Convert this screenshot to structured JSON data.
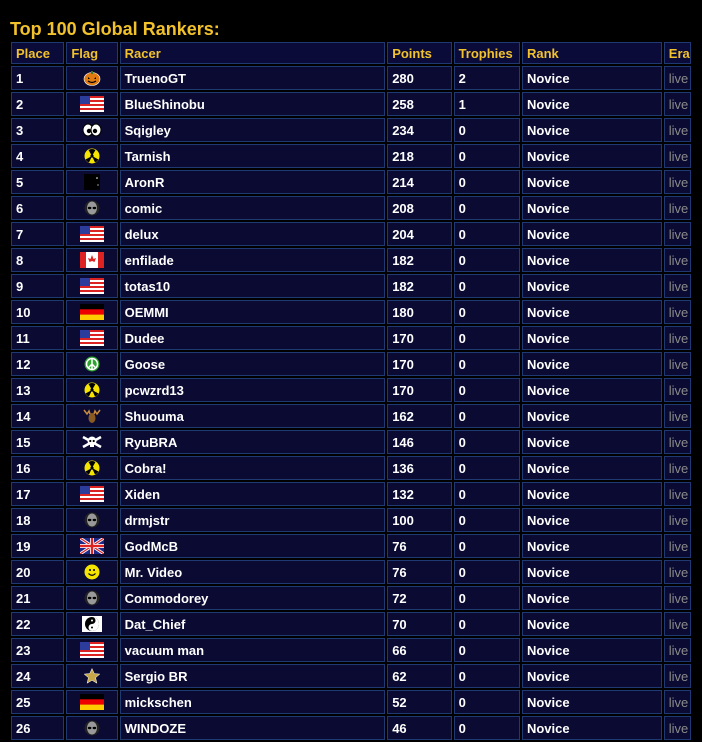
{
  "page": {
    "title": "Top 100 Global Rankers:"
  },
  "table": {
    "headers": [
      "Place",
      "Flag",
      "Racer",
      "Points",
      "Trophies",
      "Rank",
      "Era"
    ],
    "rows": [
      {
        "place": "1",
        "flag": "pumpkin-icon",
        "racer": "TruenoGT",
        "points": "280",
        "trophies": "2",
        "rank": "Novice",
        "era": "live"
      },
      {
        "place": "2",
        "flag": "usa-flag-icon",
        "racer": "BlueShinobu",
        "points": "258",
        "trophies": "1",
        "rank": "Novice",
        "era": "live"
      },
      {
        "place": "3",
        "flag": "eyes-icon",
        "racer": "Sqigley",
        "points": "234",
        "trophies": "0",
        "rank": "Novice",
        "era": "live"
      },
      {
        "place": "4",
        "flag": "radiation-icon",
        "racer": "Tarnish",
        "points": "218",
        "trophies": "0",
        "rank": "Novice",
        "era": "live"
      },
      {
        "place": "5",
        "flag": "moon-icon",
        "racer": "AronR",
        "points": "214",
        "trophies": "0",
        "rank": "Novice",
        "era": "live"
      },
      {
        "place": "6",
        "flag": "alien-icon",
        "racer": "comic",
        "points": "208",
        "trophies": "0",
        "rank": "Novice",
        "era": "live"
      },
      {
        "place": "7",
        "flag": "usa-flag-icon",
        "racer": "delux",
        "points": "204",
        "trophies": "0",
        "rank": "Novice",
        "era": "live"
      },
      {
        "place": "8",
        "flag": "canada-flag-icon",
        "racer": "enfilade",
        "points": "182",
        "trophies": "0",
        "rank": "Novice",
        "era": "live"
      },
      {
        "place": "9",
        "flag": "usa-flag-icon",
        "racer": "totas10",
        "points": "182",
        "trophies": "0",
        "rank": "Novice",
        "era": "live"
      },
      {
        "place": "10",
        "flag": "germany-flag-icon",
        "racer": "OEMMI",
        "points": "180",
        "trophies": "0",
        "rank": "Novice",
        "era": "live"
      },
      {
        "place": "11",
        "flag": "usa-flag-icon",
        "racer": "Dudee",
        "points": "170",
        "trophies": "0",
        "rank": "Novice",
        "era": "live"
      },
      {
        "place": "12",
        "flag": "peace-icon",
        "racer": "Goose",
        "points": "170",
        "trophies": "0",
        "rank": "Novice",
        "era": "live"
      },
      {
        "place": "13",
        "flag": "radiation-icon",
        "racer": "pcwzrd13",
        "points": "170",
        "trophies": "0",
        "rank": "Novice",
        "era": "live"
      },
      {
        "place": "14",
        "flag": "moose-icon",
        "racer": "Shuouma",
        "points": "162",
        "trophies": "0",
        "rank": "Novice",
        "era": "live"
      },
      {
        "place": "15",
        "flag": "skull-icon",
        "racer": "RyuBRA",
        "points": "146",
        "trophies": "0",
        "rank": "Novice",
        "era": "live"
      },
      {
        "place": "16",
        "flag": "radiation-icon",
        "racer": "Cobra!",
        "points": "136",
        "trophies": "0",
        "rank": "Novice",
        "era": "live"
      },
      {
        "place": "17",
        "flag": "usa-flag-icon",
        "racer": "Xiden",
        "points": "132",
        "trophies": "0",
        "rank": "Novice",
        "era": "live"
      },
      {
        "place": "18",
        "flag": "alien-icon",
        "racer": "drmjstr",
        "points": "100",
        "trophies": "0",
        "rank": "Novice",
        "era": "live"
      },
      {
        "place": "19",
        "flag": "uk-flag-icon",
        "racer": "GodMcB",
        "points": "76",
        "trophies": "0",
        "rank": "Novice",
        "era": "live"
      },
      {
        "place": "20",
        "flag": "smiley-icon",
        "racer": "Mr. Video",
        "points": "76",
        "trophies": "0",
        "rank": "Novice",
        "era": "live"
      },
      {
        "place": "21",
        "flag": "alien-icon",
        "racer": "Commodorey",
        "points": "72",
        "trophies": "0",
        "rank": "Novice",
        "era": "live"
      },
      {
        "place": "22",
        "flag": "yinyang-icon",
        "racer": "Dat_Chief",
        "points": "70",
        "trophies": "0",
        "rank": "Novice",
        "era": "live"
      },
      {
        "place": "23",
        "flag": "usa-flag-icon",
        "racer": "vacuum man",
        "points": "66",
        "trophies": "0",
        "rank": "Novice",
        "era": "live"
      },
      {
        "place": "24",
        "flag": "star-icon",
        "racer": "Sergio BR",
        "points": "62",
        "trophies": "0",
        "rank": "Novice",
        "era": "live"
      },
      {
        "place": "25",
        "flag": "germany-flag-icon",
        "racer": "mickschen",
        "points": "52",
        "trophies": "0",
        "rank": "Novice",
        "era": "live"
      },
      {
        "place": "26",
        "flag": "alien-icon",
        "racer": "WINDOZE",
        "points": "46",
        "trophies": "0",
        "rank": "Novice",
        "era": "live"
      }
    ]
  },
  "colors": {
    "accent": "#f2c22c",
    "cell_bg": "#0a0a33",
    "border": "#1f3a73",
    "era_text": "#8b8b8b"
  }
}
